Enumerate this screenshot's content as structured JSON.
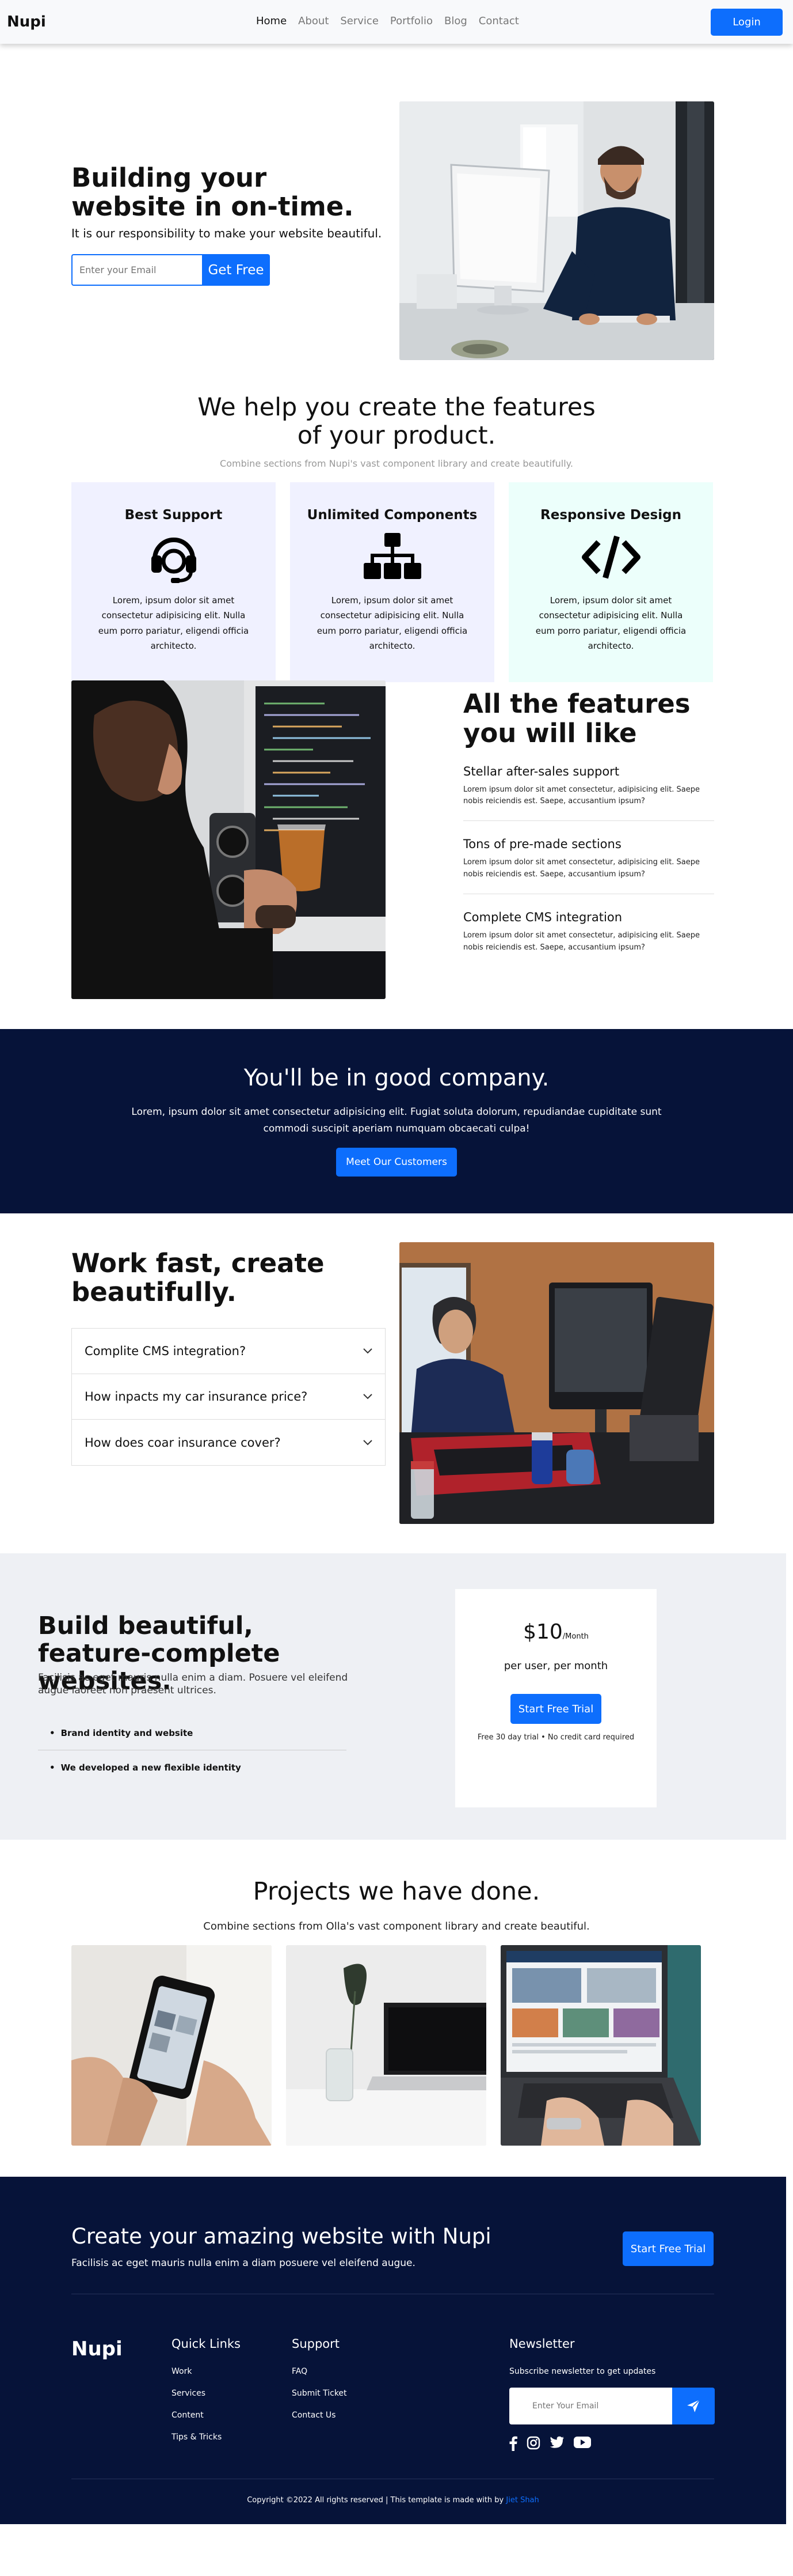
{
  "nav": {
    "brand": "Nupi",
    "links": [
      "Home",
      "About",
      "Service",
      "Portfolio",
      "Blog",
      "Contact"
    ],
    "login_label": "Login"
  },
  "hero": {
    "title": "Building your website in on-time.",
    "subtitle": "It is our responsibility to make your website beautiful.",
    "email_placeholder": "Enter your Email",
    "cta_label": "Get Free"
  },
  "features": {
    "title": "We help you create the features of your product.",
    "subtitle": "Combine sections from Nupi's vast component library and create beautifully.",
    "cards": [
      {
        "title": "Best Support",
        "icon": "headset-icon",
        "text": "Lorem, ipsum dolor sit amet consectetur adipisicing elit. Nulla eum porro pariatur, eligendi officia architecto."
      },
      {
        "title": "Unlimited Components",
        "icon": "sitemap-icon",
        "text": "Lorem, ipsum dolor sit amet consectetur adipisicing elit. Nulla eum porro pariatur, eligendi officia architecto."
      },
      {
        "title": "Responsive Design",
        "icon": "code-icon",
        "text": "Lorem, ipsum dolor sit amet consectetur adipisicing elit. Nulla eum porro pariatur, eligendi officia architecto."
      }
    ]
  },
  "all_features": {
    "title": "All the features you will like",
    "items": [
      {
        "title": "Stellar after-sales support",
        "text": "Lorem ipsum dolor sit amet consectetur, adipisicing elit. Saepe nobis reiciendis est. Saepe, accusantium ipsum?"
      },
      {
        "title": "Tons of pre-made sections",
        "text": "Lorem ipsum dolor sit amet consectetur, adipisicing elit. Saepe nobis reiciendis est. Saepe, accusantium ipsum?"
      },
      {
        "title": "Complete CMS integration",
        "text": "Lorem ipsum dolor sit amet consectetur, adipisicing elit. Saepe nobis reiciendis est. Saepe, accusantium ipsum?"
      }
    ]
  },
  "company": {
    "title": "You'll be in good company.",
    "text": "Lorem, ipsum dolor sit amet consectetur adipisicing elit. Fugiat soluta dolorum, repudiandae cupiditate sunt commodi suscipit aperiam numquam obcaecati culpa!",
    "button_label": "Meet Our Customers"
  },
  "work_fast": {
    "title": "Work fast, create beautifully.",
    "questions": [
      "Complite CMS integration?",
      "How inpacts my car insurance price?",
      "How does coar insurance cover?"
    ]
  },
  "pricing": {
    "title": "Build beautiful, feature-complete websites.",
    "subtitle": "Facilisis ac eget mauris nulla enim a diam. Posuere vel eleifend augue laoreet non praesent ultrices.",
    "list": [
      "Brand identity and website",
      "We developed a new flexible identity"
    ],
    "price": "$10",
    "unit": "/Month",
    "per": "per user, per month",
    "button_label": "Start Free Trial",
    "note": "Free 30 day trial • No credit card required"
  },
  "projects": {
    "title": "Projects we have done.",
    "subtitle": "Combine sections from Olla's vast component library and create beautiful."
  },
  "footer": {
    "cta_title": "Create your amazing website with Nupi",
    "cta_subtitle": "Facilisis ac eget mauris nulla enim a diam posuere vel eleifend augue.",
    "cta_button": "Start Free Trial",
    "brand": "Nupi",
    "quick_links": {
      "title": "Quick Links",
      "links": [
        "Work",
        "Services",
        "Content",
        "Tips & Tricks"
      ]
    },
    "support": {
      "title": "Support",
      "links": [
        "FAQ",
        "Submit Ticket",
        "Contact Us"
      ]
    },
    "newsletter": {
      "title": "Newsletter",
      "text": "Subscribe newsletter to get updates",
      "placeholder": "Enter Your Email"
    },
    "copyright": "Copyright ©2022 All rights reserved | This template is made with by",
    "credit": "Jiet Shah"
  },
  "colors": {
    "accent": "#0d6efd",
    "navy": "#061339",
    "lavender": "#f0f1ff",
    "mint": "#ecfffb",
    "light_gray": "#eef0f4"
  }
}
